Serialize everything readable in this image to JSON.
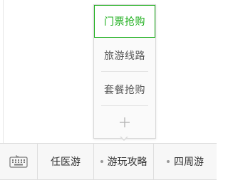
{
  "popup_menu": {
    "items": [
      {
        "label": "门票抢购",
        "active": true
      },
      {
        "label": "旅游线路",
        "active": false
      },
      {
        "label": "套餐抢购",
        "active": false
      }
    ],
    "add_icon": "plus-icon"
  },
  "menu_bar": {
    "keyboard_icon": "keyboard-icon",
    "items": [
      {
        "label": "任医游"
      },
      {
        "label": "游玩攻略"
      },
      {
        "label": "四周游"
      }
    ]
  },
  "colors": {
    "accent": "#1aad19",
    "text": "#333333",
    "border": "#dedede",
    "background": "#f7f7f7"
  }
}
